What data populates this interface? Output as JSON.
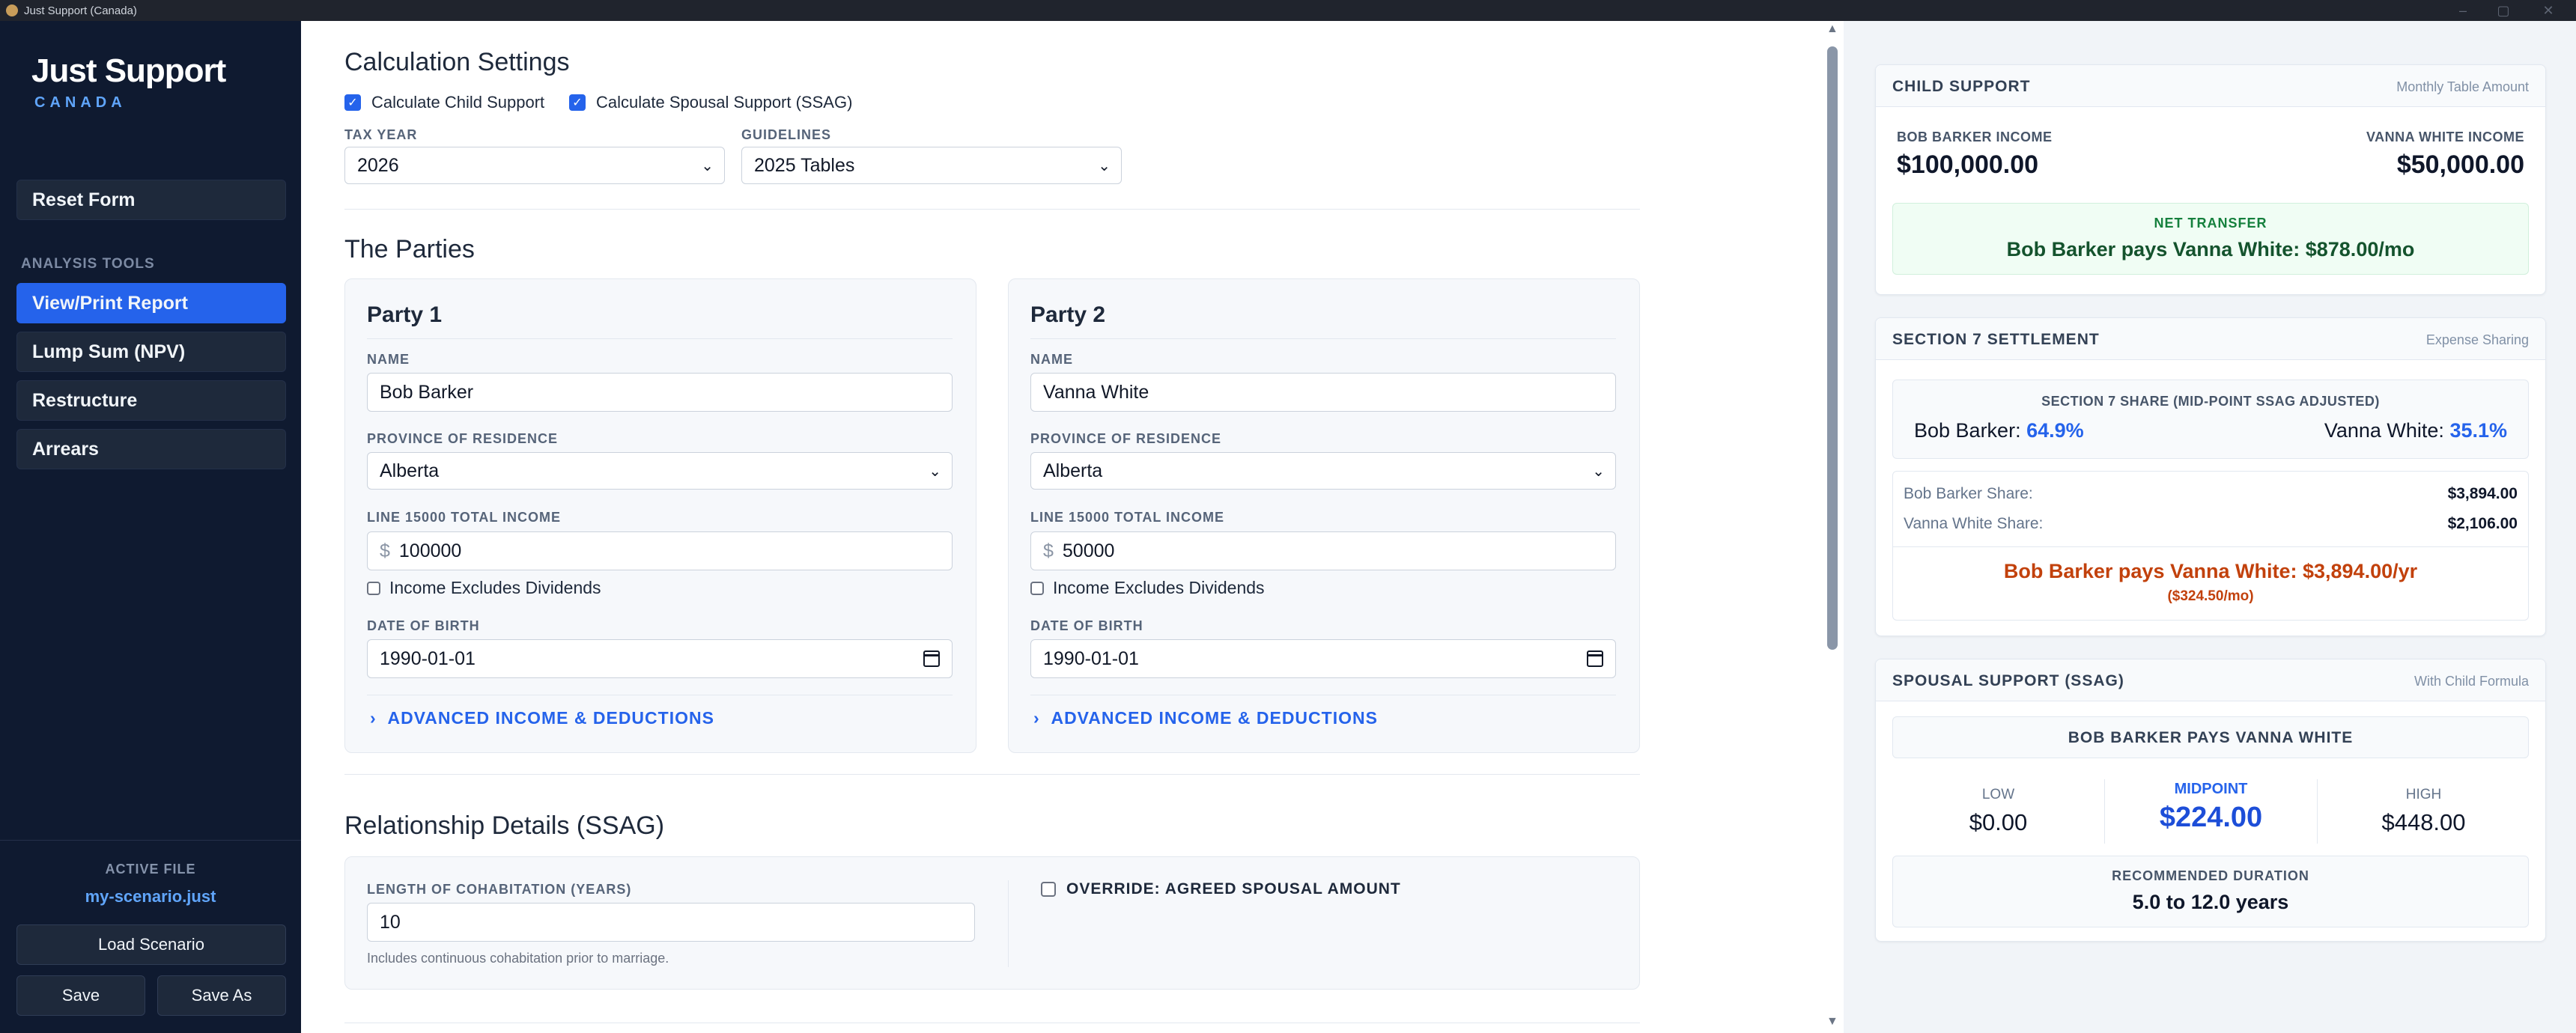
{
  "window": {
    "title": "Just Support (Canada)"
  },
  "sidebar": {
    "brand_title": "Just Support",
    "brand_subtitle": "CANADA",
    "reset_label": "Reset Form",
    "section_label": "ANALYSIS TOOLS",
    "nav": [
      "View/Print Report",
      "Lump Sum (NPV)",
      "Restructure",
      "Arrears"
    ],
    "active_file_label": "ACTIVE FILE",
    "active_file_name": "my-scenario.just",
    "load_label": "Load Scenario",
    "save_label": "Save",
    "save_as_label": "Save As"
  },
  "settings": {
    "title": "Calculation Settings",
    "calc_child_label": "Calculate Child Support",
    "calc_spousal_label": "Calculate Spousal Support (SSAG)",
    "calc_child_checked": true,
    "calc_spousal_checked": true,
    "tax_year_label": "TAX YEAR",
    "tax_year_value": "2026",
    "guidelines_label": "GUIDELINES",
    "guidelines_value": "2025 Tables"
  },
  "parties": {
    "title": "The Parties",
    "name_label": "NAME",
    "province_label": "PROVINCE OF RESIDENCE",
    "income_label": "LINE 15000 TOTAL INCOME",
    "currency_symbol": "$",
    "dividends_label": "Income Excludes Dividends",
    "dob_label": "DATE OF BIRTH",
    "advanced_label": "ADVANCED INCOME & DEDUCTIONS",
    "party1": {
      "title": "Party 1",
      "name": "Bob Barker",
      "province": "Alberta",
      "income": "100000",
      "dob": "1990-01-01"
    },
    "party2": {
      "title": "Party 2",
      "name": "Vanna White",
      "province": "Alberta",
      "income": "50000",
      "dob": "1990-01-01"
    }
  },
  "relationship": {
    "title": "Relationship Details (SSAG)",
    "cohab_label": "LENGTH OF COHABITATION (YEARS)",
    "cohab_value": "10",
    "cohab_hint": "Includes continuous cohabitation prior to marriage.",
    "override_label": "OVERRIDE: AGREED SPOUSAL AMOUNT"
  },
  "results": {
    "child_support": {
      "title": "CHILD SUPPORT",
      "subtitle": "Monthly Table Amount",
      "p1_income_label": "BOB BARKER INCOME",
      "p1_income": "$100,000.00",
      "p2_income_label": "VANNA WHITE INCOME",
      "p2_income": "$50,000.00",
      "net_label": "NET TRANSFER",
      "net_text": "Bob Barker pays Vanna White: $878.00/mo"
    },
    "section7": {
      "title": "SECTION 7 SETTLEMENT",
      "subtitle": "Expense Sharing",
      "share_label": "SECTION 7 SHARE (MID-POINT SSAG ADJUSTED)",
      "p1_name": "Bob Barker:",
      "p1_pct": "64.9%",
      "p2_name": "Vanna White:",
      "p2_pct": "35.1%",
      "p1_share_label": "Bob Barker Share:",
      "p1_share": "$3,894.00",
      "p2_share_label": "Vanna White Share:",
      "p2_share": "$2,106.00",
      "pays_text": "Bob Barker pays Vanna White: $3,894.00/yr",
      "pays_monthly": "($324.50/mo)"
    },
    "spousal": {
      "title": "SPOUSAL SUPPORT (SSAG)",
      "subtitle": "With Child Formula",
      "direction": "BOB BARKER PAYS VANNA WHITE",
      "low_label": "LOW",
      "low": "$0.00",
      "mid_label": "MIDPOINT",
      "mid": "$224.00",
      "high_label": "HIGH",
      "high": "$448.00",
      "duration_label": "RECOMMENDED DURATION",
      "duration": "5.0 to 12.0 years"
    }
  },
  "colors": {
    "accent": "#2563eb",
    "sidebar": "#0f1a30",
    "success": "#15603a",
    "warning": "#b45309"
  }
}
